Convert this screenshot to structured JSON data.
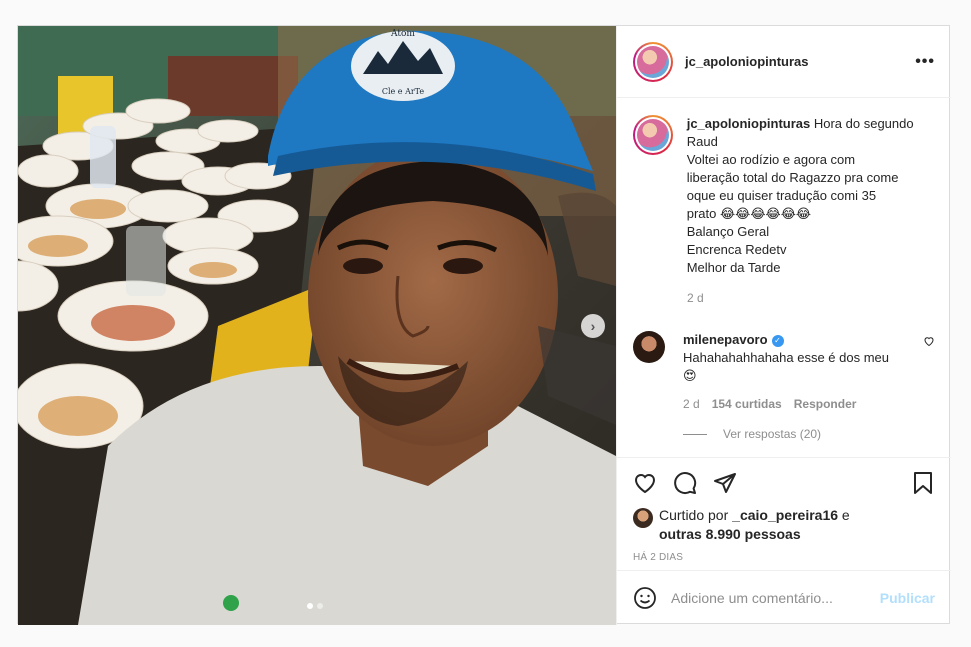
{
  "post": {
    "username": "jc_apoloniopinturas",
    "more_label": "•••",
    "caption": {
      "username": "jc_apoloniopinturas",
      "lines": [
        "Hora do segundo",
        "Raud",
        "Voltei ao rodízio e agora com",
        "liberação total do Ragazzo pra come",
        "oque eu quiser tradução comi 35",
        "prato 😂😂😂😂😂😂",
        "Balanço Geral",
        "Encrenca Redetv",
        "Melhor da Tarde"
      ],
      "age": "2 d"
    },
    "comment": {
      "username": "milenepavoro",
      "verified_mark": "✓",
      "text": "Hahahahahhahaha esse é dos meu 😍",
      "age": "2 d",
      "likes": "154 curtidas",
      "reply_label": "Responder",
      "view_replies": "Ver respostas (20)"
    },
    "likes": {
      "prefix": "Curtido por",
      "user": "_caio_pereira16",
      "joiner": "e",
      "others": "outras 8.990 pessoas"
    },
    "timestamp": "HÁ 2 DIAS",
    "add_comment": {
      "placeholder": "Adicione um comentário...",
      "publish_label": "Publicar"
    },
    "media": {
      "helmet_logo_top": "Atom",
      "helmet_logo_bottom": "Cle e ArTe",
      "next_label": "›",
      "slide_count": 2,
      "current_slide": 1
    }
  },
  "colors": {
    "link_blue": "#0095f6",
    "publish_disabled": "#b2dffc",
    "verified": "#3897f0",
    "helmet": "#1e78c2"
  }
}
